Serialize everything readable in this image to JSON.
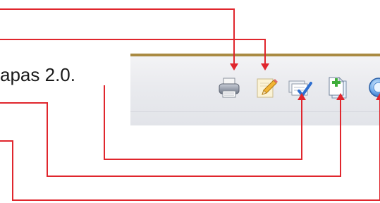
{
  "document": {
    "caption_fragment": "apas 2.0."
  },
  "toolbar": {
    "buttons": [
      {
        "id": "print",
        "icon": "printer-icon"
      },
      {
        "id": "edit",
        "icon": "pencil-edit-icon"
      },
      {
        "id": "verify",
        "icon": "document-checkmark-icon"
      },
      {
        "id": "new",
        "icon": "new-document-plus-icon"
      },
      {
        "id": "navigate",
        "icon": "blue-circle-icon"
      }
    ],
    "border_color": "#a98a42"
  },
  "annotations": {
    "arrow_color": "#e0262d"
  }
}
